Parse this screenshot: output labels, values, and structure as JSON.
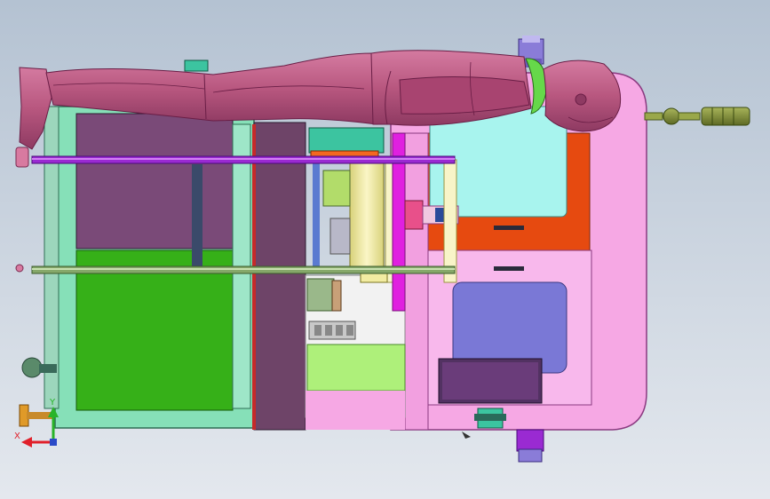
{
  "viewport": {
    "background_top": "#b4c2d2",
    "background_bottom": "#e4e8ee"
  },
  "triad": {
    "x_label": "X",
    "y_label": "Y",
    "x_color": "#e0202a",
    "y_color": "#28b428"
  },
  "colors": {
    "figure": "#b8577f",
    "figure_dark": "#7e2e55",
    "collar": "#66d84a",
    "frame_mint": "#86e0b8",
    "panel_purple": "#7a4a78",
    "panel_green": "#36b018",
    "column_mauve": "#6e4468",
    "cabinet_pink": "#f6a8e4",
    "cabinet_orange": "#e64a10",
    "screen_cyan": "#a8f4ee",
    "display_blue": "#7a78d6",
    "monitor_dark": "#523262",
    "rail_purple": "#9a2ad2",
    "carriage_teal": "#3cc4a0",
    "carriage_orange": "#f46820",
    "slide_yellow": "#f2eca2",
    "gear_grey": "#c8c8c8",
    "knob_olive": "#7e8e3a"
  }
}
